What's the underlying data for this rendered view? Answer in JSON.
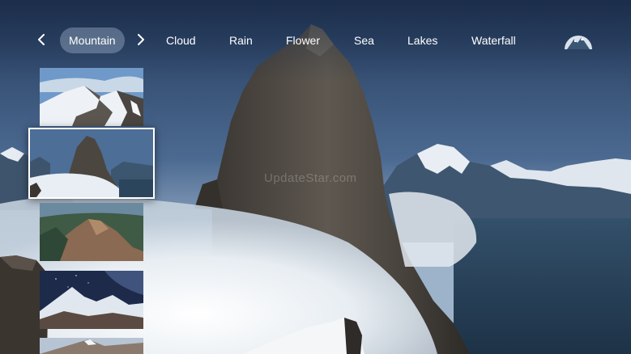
{
  "categories": {
    "items": [
      {
        "label": "Mountain",
        "active": true
      },
      {
        "label": "Cloud"
      },
      {
        "label": "Rain"
      },
      {
        "label": "Flower"
      },
      {
        "label": "Sea"
      },
      {
        "label": "Lakes"
      },
      {
        "label": "Waterfall"
      }
    ],
    "prev_icon": "chevron-left-icon",
    "next_icon": "chevron-right-icon"
  },
  "logo_icon": "mountain-logo-icon",
  "watermark": "UpdateStar.com",
  "thumbnails": [
    {
      "name": "thumb-snowy-ridge"
    },
    {
      "name": "thumb-misty-peak",
      "selected": true
    },
    {
      "name": "thumb-rocky-valley"
    },
    {
      "name": "thumb-night-mountains"
    },
    {
      "name": "thumb-snowy-summit"
    }
  ],
  "colors": {
    "accent": "#ffffff",
    "active_pill": "#8fa3bd",
    "sky": "#2c4a73"
  }
}
